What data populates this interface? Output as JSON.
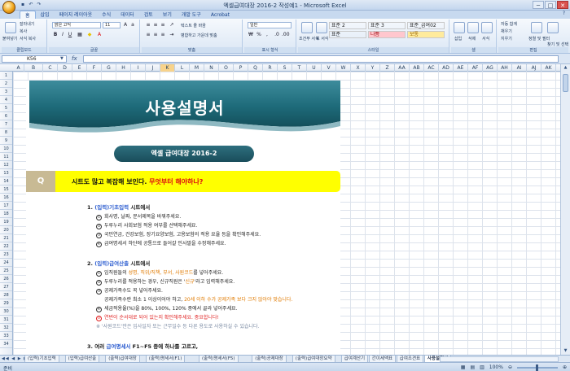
{
  "window": {
    "title": "엑셀급여대장 2016-2 작성예1 - Microsoft Excel",
    "buttons": [
      "─",
      "□",
      "✕"
    ]
  },
  "ribbon_tabs": [
    "홈",
    "삽입",
    "페이지 레이아웃",
    "수식",
    "데이터",
    "검토",
    "보기",
    "개발 도구",
    "Acrobat"
  ],
  "ribbon": {
    "clipboard": {
      "paste": "붙여넣기",
      "cut": "잘라내기",
      "copy": "복사",
      "format_painter": "서식 복사",
      "label": "클립보드"
    },
    "font": {
      "name": "맑은 고딕",
      "size": "11",
      "label": "글꼴"
    },
    "alignment": {
      "wrap": "텍스트 줄 바꿈",
      "merge": "병합하고 가운데 맞춤",
      "label": "맞춤"
    },
    "number": {
      "format": "일반",
      "label": "표시 형식"
    },
    "styles": {
      "conditional": "조건부 서식",
      "table": "표 서식",
      "cells": [
        {
          "name": "표준 2",
          "bg": "#ffffff",
          "fg": "#222222"
        },
        {
          "name": "표준 3",
          "bg": "#ffffff",
          "fg": "#222222"
        },
        {
          "name": "표준_급여02",
          "bg": "#ffffff",
          "fg": "#222222"
        },
        {
          "name": "표준",
          "bg": "#ffffff",
          "fg": "#222222"
        },
        {
          "name": "나쁨",
          "bg": "#ffc7ce",
          "fg": "#9c0006"
        },
        {
          "name": "보통",
          "bg": "#ffeb9c",
          "fg": "#9c6500"
        }
      ],
      "label": "스타일"
    },
    "cells": {
      "insert": "삽입",
      "delete": "삭제",
      "format": "서식",
      "label": "셀"
    },
    "editing": {
      "autosum": "자동 합계",
      "fill": "채우기",
      "clear": "지우기",
      "sort": "정렬 및 필터",
      "find": "찾기 및 선택",
      "label": "편집"
    }
  },
  "formula_bar": {
    "name_box": "K56",
    "fx": "fx",
    "value": ""
  },
  "columns": [
    "A",
    "B",
    "C",
    "D",
    "E",
    "F",
    "G",
    "H",
    "I",
    "J",
    "K",
    "L",
    "M",
    "N",
    "O",
    "P",
    "Q",
    "R",
    "S",
    "T",
    "U",
    "V",
    "W",
    "X",
    "Y",
    "Z",
    "AA",
    "AB",
    "AC",
    "AD",
    "AE",
    "AF",
    "AG",
    "AH",
    "AI",
    "AJ",
    "AK"
  ],
  "selected_column": "K",
  "rows": [
    "1",
    "2",
    "3",
    "4",
    "5",
    "6",
    "7",
    "8",
    "9",
    "10",
    "11",
    "12",
    "13",
    "14",
    "15",
    "16",
    "17",
    "18",
    "19",
    "20",
    "21",
    "22",
    "23",
    "24",
    "25",
    "26",
    "27",
    "28",
    "29",
    "30",
    "31",
    "32",
    "33",
    "34"
  ],
  "document": {
    "banner_title": "사용설명서",
    "pill": "엑셀 급여대장 2016-2",
    "q_badge": "Q",
    "q_text_black": "시트도 많고 복잡해 보인다. ",
    "q_text_red": "무엇부터 해야하나?",
    "sec1": {
      "num": "1. ",
      "hl": "(입력)기초입력",
      "rest": " 시트에서"
    },
    "sec1_items": [
      {
        "n": "①",
        "t": "회사명, 날짜, 문서제목을 바꿔주세요."
      },
      {
        "n": "②",
        "t": "두루누리 사회보험 적용 여부를 선택해주세요."
      },
      {
        "n": "③",
        "t": "국민연금, 건강보험, 장기요양보험, 고용보험의 적용 요율 등을 확인해주세요."
      },
      {
        "n": "④",
        "t": "급여명세서 하단에 공통으로 들어갈 인사말을 수정해주세요."
      }
    ],
    "sec2": {
      "num": "2. ",
      "hl": "(입력)급여산출",
      "rest": " 시트에서"
    },
    "sec2_item1": {
      "n": "①",
      "a": "임직원들의 ",
      "b": "성명, 직위/직책, 부서, 사원코드",
      "c": "를 넣어주세요."
    },
    "sec2_item2": {
      "n": "②",
      "a": "두루누리를 적용하는 경우, 신규직원은 '",
      "b": "신규",
      "c": "'라고 입력해주세요."
    },
    "sec2_item3": {
      "n": "③",
      "t": "공제가족수도 꼭 넣어주세요."
    },
    "sec2_item3b": {
      "a": "공제가족수란 최소 1 이상이어야 하고, ",
      "b": "20세 이하 수가 공제가족 보다 크지 않아야 맞습니다."
    },
    "sec2_item4": {
      "n": "④",
      "t": "세금적용율(%)을 80%, 100%, 120% 중에서 골라 넣어주세요."
    },
    "sec2_item5": {
      "n": "⑤",
      "t": "연번이 순서대로 되어 있는지 확인해주세요. 중요합니다!"
    },
    "sec2_note": "※ '사원코드'만은 입사일자 또는 근무일수 등 다른 용도로 사용하실 수 있습니다.",
    "sec3": {
      "num": "3. ",
      "a": "여러 ",
      "hl": "급여명세서",
      "b": " F1~F5 중에 하나를 고르고,"
    }
  },
  "sheet_tabs": [
    "(입력)기초입력",
    "(입력)급여산출",
    "(출력)급여대장",
    "(출력)명세서(F1)",
    "(출력)명세서(F5)",
    "(출력)공제대장",
    "(출력)급여대장요약",
    "급여계산기",
    "간이세액표",
    "급여조견표",
    "사용설명서"
  ],
  "active_sheet": "사용설명서",
  "status": {
    "left": "준비",
    "zoom": "100%"
  },
  "colors": {
    "banner": "#1e6b7a",
    "qbar": "#ffff00",
    "accent_blue": "#2f5fd0",
    "accent_red": "#e02020"
  }
}
